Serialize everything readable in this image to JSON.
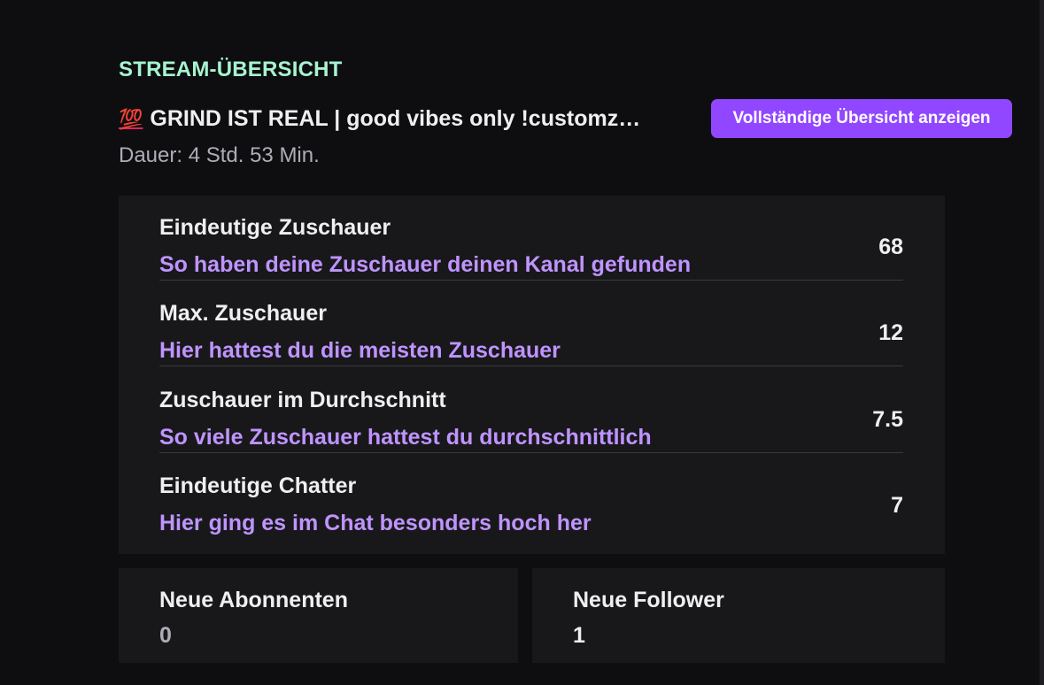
{
  "header": {
    "section_label": "STREAM-ÜBERSICHT",
    "title_emoji": "💯",
    "stream_title": "GRIND IST REAL | good vibes only !customz…",
    "full_overview_button": "Vollständige Übersicht anzeigen",
    "duration": "Dauer: 4 Std. 53 Min."
  },
  "stats": [
    {
      "name": "Eindeutige Zuschauer",
      "link": "So haben deine Zuschauer deinen Kanal gefunden",
      "value": "68"
    },
    {
      "name": "Max. Zuschauer",
      "link": "Hier hattest du die meisten Zuschauer",
      "value": "12"
    },
    {
      "name": "Zuschauer im Durchschnitt",
      "link": "So viele Zuschauer hattest du durchschnittlich",
      "value": "7.5"
    },
    {
      "name": "Eindeutige Chatter",
      "link": "Hier ging es im Chat besonders hoch her",
      "value": "7"
    }
  ],
  "subscribers": {
    "label": "Neue Abonnenten",
    "value": "0",
    "value_color": "#adadb8"
  },
  "followers": {
    "label": "Neue Follower",
    "value": "1",
    "value_color": "#efeff1"
  },
  "colors": {
    "accent": "#9147ff",
    "link": "#bf94ff",
    "section_label": "#a7f3d0",
    "background": "#0e0e10",
    "card": "#18181b"
  }
}
